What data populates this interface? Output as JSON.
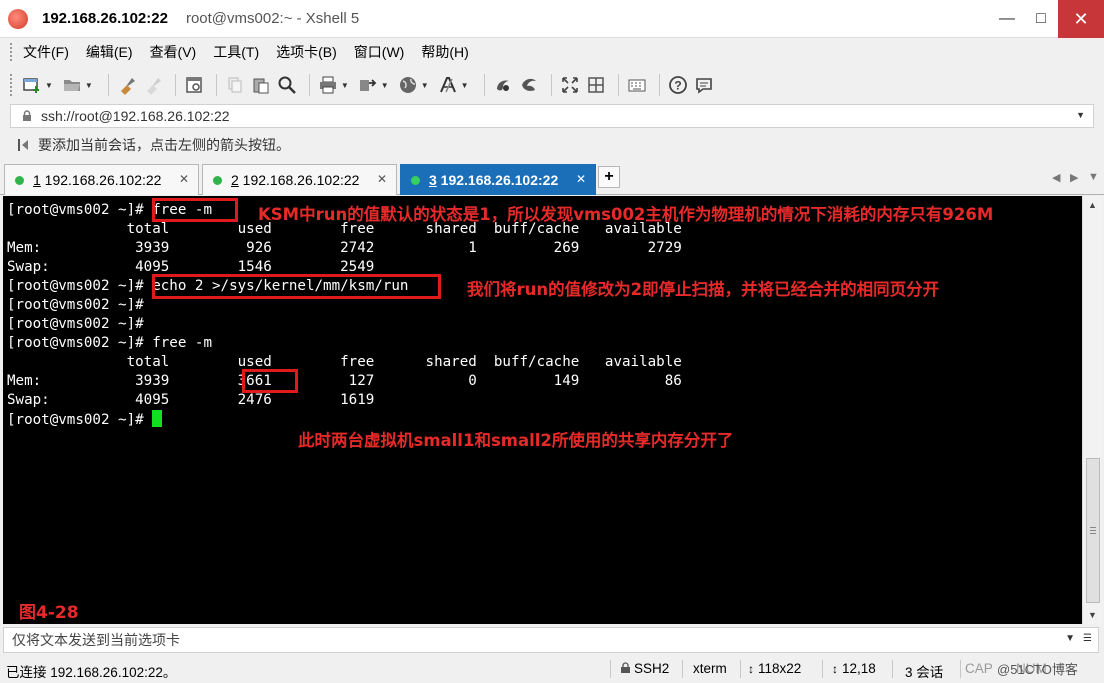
{
  "window": {
    "title_host": "192.168.26.102:22",
    "title_rest": "root@vms002:~ - Xshell 5",
    "minimize": "—",
    "maximize": "□",
    "close": "✕"
  },
  "menu": [
    "文件(F)",
    "编辑(E)",
    "查看(V)",
    "工具(T)",
    "选项卡(B)",
    "窗口(W)",
    "帮助(H)"
  ],
  "toolbar_icons": [
    "new-session-icon",
    "open-folder-icon",
    "reconnect-icon",
    "disconnect-icon",
    "properties-icon",
    "copy-icon",
    "paste-icon",
    "find-icon",
    "print-icon",
    "transfer-icon",
    "globe-icon",
    "font-icon",
    "xftp-icon",
    "xagent-icon",
    "fullscreen-icon",
    "lock-icon",
    "keyboard-icon",
    "help-icon",
    "chat-icon"
  ],
  "address": {
    "value": "ssh://root@192.168.26.102:22"
  },
  "hint": {
    "text": "要添加当前会话，点击左侧的箭头按钮。"
  },
  "tabs": [
    {
      "num": "1",
      "label": " 192.168.26.102:22",
      "active": false
    },
    {
      "num": "2",
      "label": " 192.168.26.102:22",
      "active": false
    },
    {
      "num": "3",
      "label": " 192.168.26.102:22",
      "active": true
    }
  ],
  "tab_add": "+",
  "terminal": {
    "lines": [
      "[root@vms002 ~]# free -m",
      "              total        used        free      shared  buff/cache   available",
      "Mem:           3939         926        2742           1         269        2729",
      "Swap:          4095        1546        2549",
      "[root@vms002 ~]# echo 2 >/sys/kernel/mm/ksm/run",
      "[root@vms002 ~]#",
      "[root@vms002 ~]#",
      "[root@vms002 ~]# free -m",
      "              total        used        free      shared  buff/cache   available",
      "Mem:           3939        3661         127           0         149          86",
      "Swap:          4095        2476        1619",
      "[root@vms002 ~]# "
    ]
  },
  "annotations": {
    "note1": "KSM中run的值默认的状态是1，所以发现vms002主机作为物理机的情况下消耗的内存只有926M",
    "note2": "我们将run的值修改为2即停止扫描，并将已经合并的相同页分开",
    "note3": "此时两台虚拟机small1和small2所使用的共享内存分开了",
    "figure": "图4-28"
  },
  "input": {
    "placeholder": "仅将文本发送到当前选项卡"
  },
  "status": {
    "connection": "已连接 192.168.26.102:22。",
    "protocol": "SSH2",
    "terminal_type": "xterm",
    "size": "118x22",
    "cursor_pos": "12,18",
    "sessions": "3 会话",
    "caps": "CAP",
    "num": "NUM",
    "watermark": "@51CTO博客"
  },
  "colors": {
    "accent_tab": "#1b6fb8",
    "terminal_bg": "#000000",
    "terminal_fg": "#ffffff",
    "cursor": "#11e021",
    "annotation": "#e62a2a",
    "close_btn": "#c7373a"
  }
}
